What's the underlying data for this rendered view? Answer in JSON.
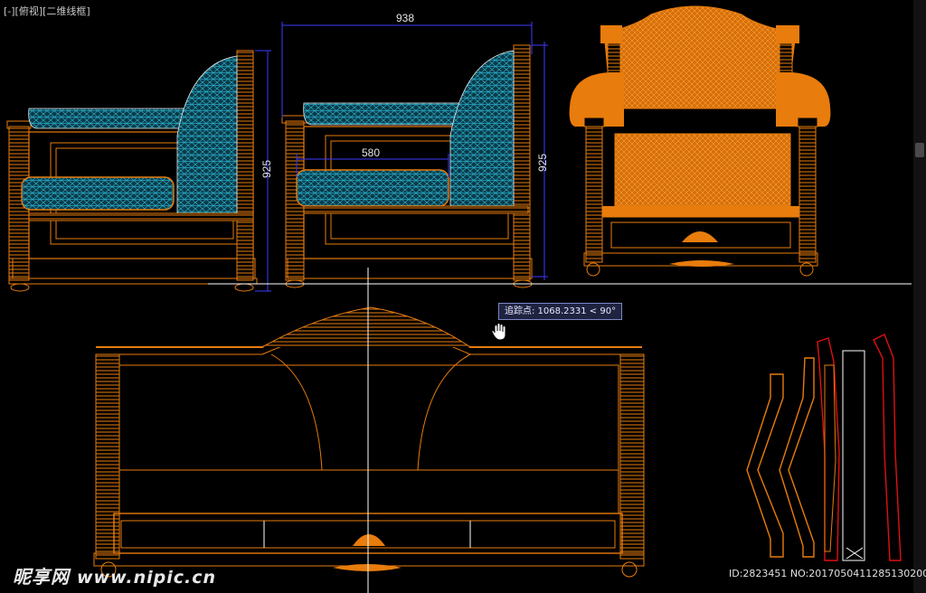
{
  "viewport": {
    "label": "[-][俯视][二维线框]"
  },
  "dimensions": {
    "top_width": "938",
    "side_height": "925",
    "front_height": "925",
    "cushion_width": "580"
  },
  "tooltip": {
    "text": "追踪点: 1068.2331 < 90°"
  },
  "watermark": {
    "brand": "昵享网",
    "url": "www.nipic.cn"
  },
  "image_id": "ID:2823451 NO:20170504112851302000",
  "colors": {
    "background": "#000000",
    "wood": "#e87c0c",
    "cushion": "#1fa0b8",
    "dimension": "#3b3bff",
    "crosshair": "#ffffff",
    "section_red": "#e01010"
  },
  "icons": {
    "cursor": "hand-cursor-icon"
  }
}
